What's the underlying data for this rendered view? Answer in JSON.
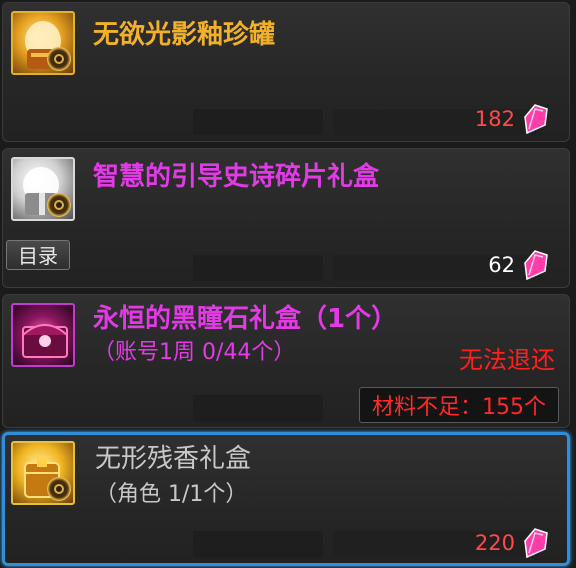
{
  "items": [
    {
      "name": "无欲光影釉珍罐",
      "name_color": "#f2b12b",
      "price": "182",
      "price_color": "#ff4a4a",
      "icon": "jar-icon"
    },
    {
      "name": "智慧的引导史诗碎片礼盒",
      "name_color": "#e23be6",
      "price": "62",
      "price_color": "#ffffff",
      "icon": "gift-box-icon"
    },
    {
      "name": "永恒的黑瞳石礼盒（1个）",
      "subtitle": "（账号1周 0/44个）",
      "name_color": "#e23be6",
      "warning": "无法退还",
      "shortage_label": "材料不足：",
      "shortage_value": "155个",
      "icon": "chest-icon"
    },
    {
      "name": "无形残香礼盒",
      "subtitle": "（角色 1/1个）",
      "name_color": "#c8c8c8",
      "price": "220",
      "price_color": "#ff4a4a",
      "icon": "gold-box-icon"
    }
  ],
  "catalog_tab": "目录",
  "colors": {
    "crystal": "#ff3da8",
    "selected_border": "#2f8fd8"
  },
  "currency_icon": "pink-crystal-icon"
}
